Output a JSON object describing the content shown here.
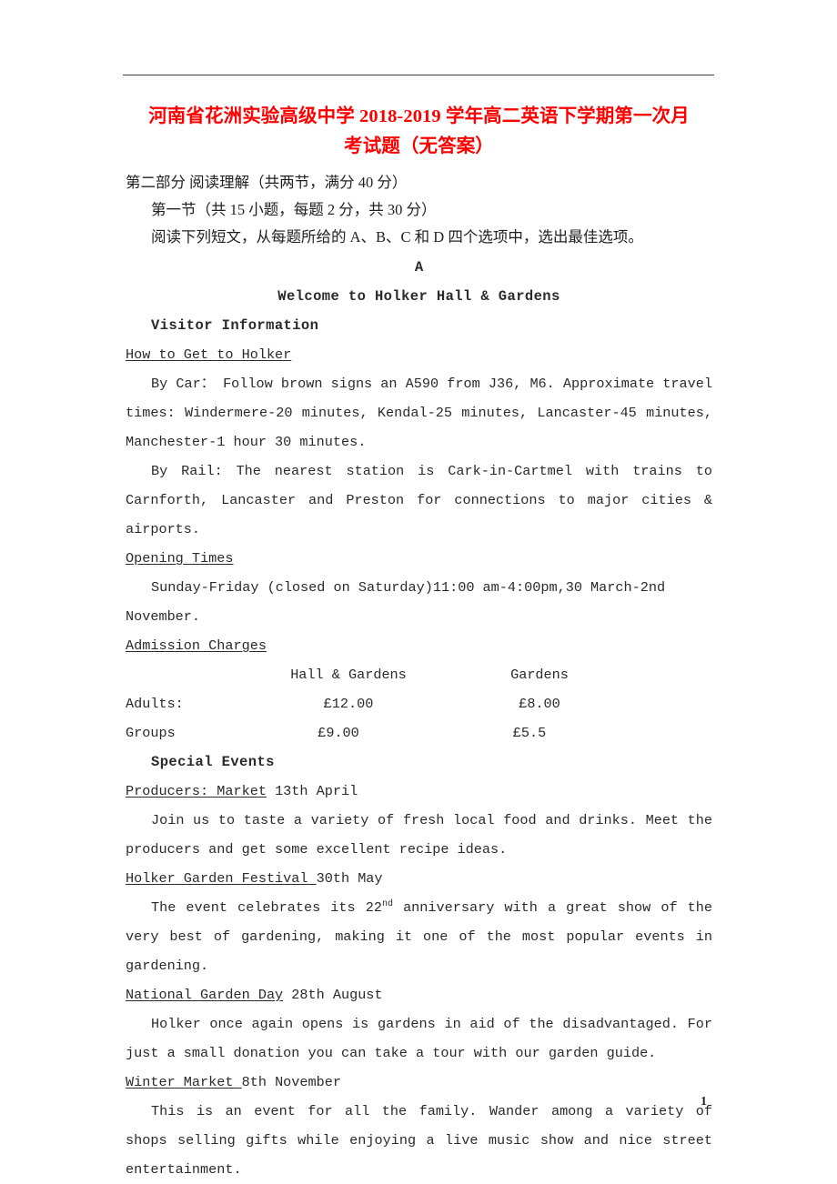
{
  "document": {
    "title_line_1": "河南省花洲实验高级中学 2018-2019 学年高二英语下学期第一次月",
    "title_line_2": "考试题（无答案）",
    "title_color": "#ff0000",
    "page_number": "1"
  },
  "instructions": {
    "part_heading": "第二部分 阅读理解（共两节，满分 40 分）",
    "section_heading": "第一节（共 15 小题，每题 2 分，共 30 分）",
    "directions": "阅读下列短文，从每题所给的 A、B、C 和 D 四个选项中，选出最佳选项。"
  },
  "passage": {
    "letter": "A",
    "title": "Welcome to Holker Hall & Gardens",
    "visitor_information_heading": "Visitor Information",
    "how_to_get_heading": "How to Get to Holker",
    "by_car": "By Car： Follow brown signs an A590 from J36, M6. Approximate travel times: Windermere-20 minutes, Kendal-25 minutes, Lancaster-45 minutes, Manchester-1 hour 30 minutes.",
    "by_rail": "By Rail: The nearest station is Cark-in-Cartmel with trains to Carnforth, Lancaster and Preston for connections to major cities & airports.",
    "opening_times_heading": "Opening Times",
    "opening_times": "Sunday-Friday (closed on Saturday)11:00 am-4:00pm,30 March-2nd November.",
    "admission_charges_heading": "Admission Charges",
    "charges_table": {
      "headers": [
        "",
        "Hall & Gardens",
        "Gardens"
      ],
      "rows": [
        [
          "Adults:",
          "£12.00",
          "£8.00"
        ],
        [
          "Groups",
          "£9.00",
          "£5.5"
        ]
      ]
    },
    "special_events_heading": "Special Events",
    "events": [
      {
        "name": "Producers: Market",
        "date": " 13th April",
        "body_pre": "Join us to taste a variety of fresh local food and drinks. Meet the producers and get some excellent recipe ideas.",
        "body_post": ""
      },
      {
        "name": "Holker Garden Festival ",
        "date": "30th May",
        "body_pre": "The event celebrates its 22",
        "sup": "nd",
        "body_post": " anniversary with a great show of the very best of gardening,  making it one of the most popular events in gardening."
      },
      {
        "name": "National Garden Day",
        "date": " 28th August",
        "body_pre": "Holker once again opens is gardens in aid of the disadvantaged. For just a small donation you can take a tour with our garden guide.",
        "body_post": ""
      },
      {
        "name": "Winter Market ",
        "date": "8th November",
        "body_pre": "This is an event for all the family. Wander among a variety of shops selling gifts while enjoying a live music show and nice street entertainment.",
        "body_post": ""
      }
    ]
  }
}
